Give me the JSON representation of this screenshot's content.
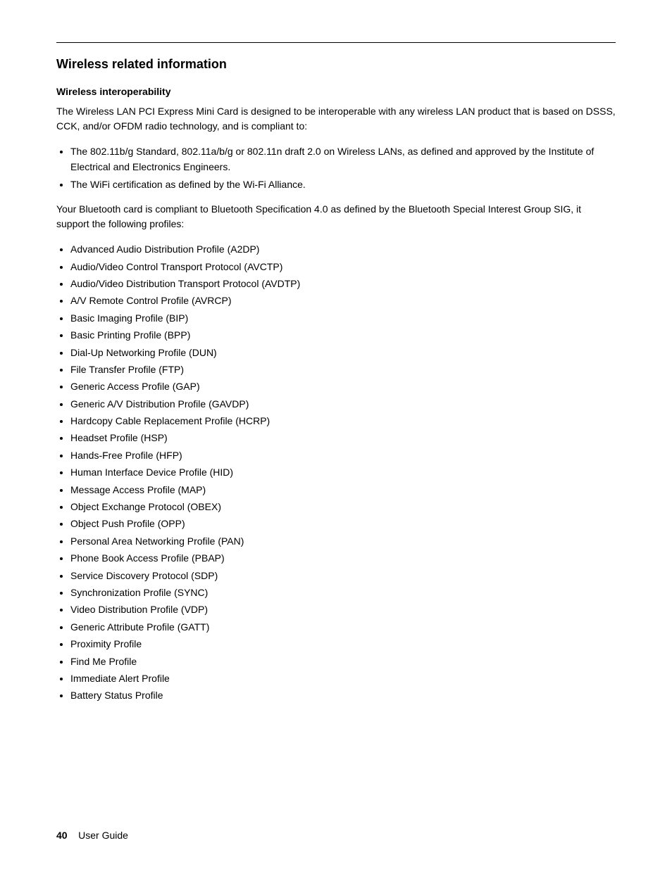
{
  "page": {
    "footer": {
      "page_number": "40",
      "label": "User Guide"
    },
    "section": {
      "title": "Wireless related information",
      "subsection_title": "Wireless interoperability",
      "para1": "The Wireless LAN PCI Express Mini Card is designed to be interoperable with any wireless LAN product that is based on DSSS, CCK, and/or OFDM radio technology, and is compliant to:",
      "bullet1_items": [
        "The 802.11b/g Standard, 802.11a/b/g or 802.11n draft 2.0 on Wireless LANs, as defined and approved by the Institute of Electrical and Electronics Engineers.",
        "The WiFi certification as defined by the Wi-Fi Alliance."
      ],
      "para2": "Your Bluetooth card is compliant to Bluetooth Specification 4.0 as defined by the Bluetooth Special Interest Group SIG, it support the following profiles:",
      "bullet2_items": [
        "Advanced Audio Distribution Profile (A2DP)",
        "Audio/Video Control Transport Protocol (AVCTP)",
        "Audio/Video Distribution Transport Protocol (AVDTP)",
        "A/V Remote Control Profile (AVRCP)",
        "Basic Imaging Profile (BIP)",
        "Basic Printing Profile (BPP)",
        "Dial-Up Networking Profile (DUN)",
        "File Transfer Profile (FTP)",
        "Generic Access Profile (GAP)",
        "Generic A/V Distribution Profile (GAVDP)",
        "Hardcopy Cable Replacement Profile (HCRP)",
        "Headset Profile (HSP)",
        "Hands-Free Profile (HFP)",
        "Human Interface Device Profile (HID)",
        "Message Access Profile (MAP)",
        "Object Exchange Protocol (OBEX)",
        "Object Push Profile (OPP)",
        "Personal Area Networking Profile (PAN)",
        "Phone Book Access Profile (PBAP)",
        "Service Discovery Protocol (SDP)",
        "Synchronization Profile (SYNC)",
        "Video Distribution Profile (VDP)",
        "Generic Attribute Profile (GATT)",
        "Proximity Profile",
        "Find Me Profile",
        "Immediate Alert Profile",
        "Battery Status Profile"
      ]
    }
  }
}
